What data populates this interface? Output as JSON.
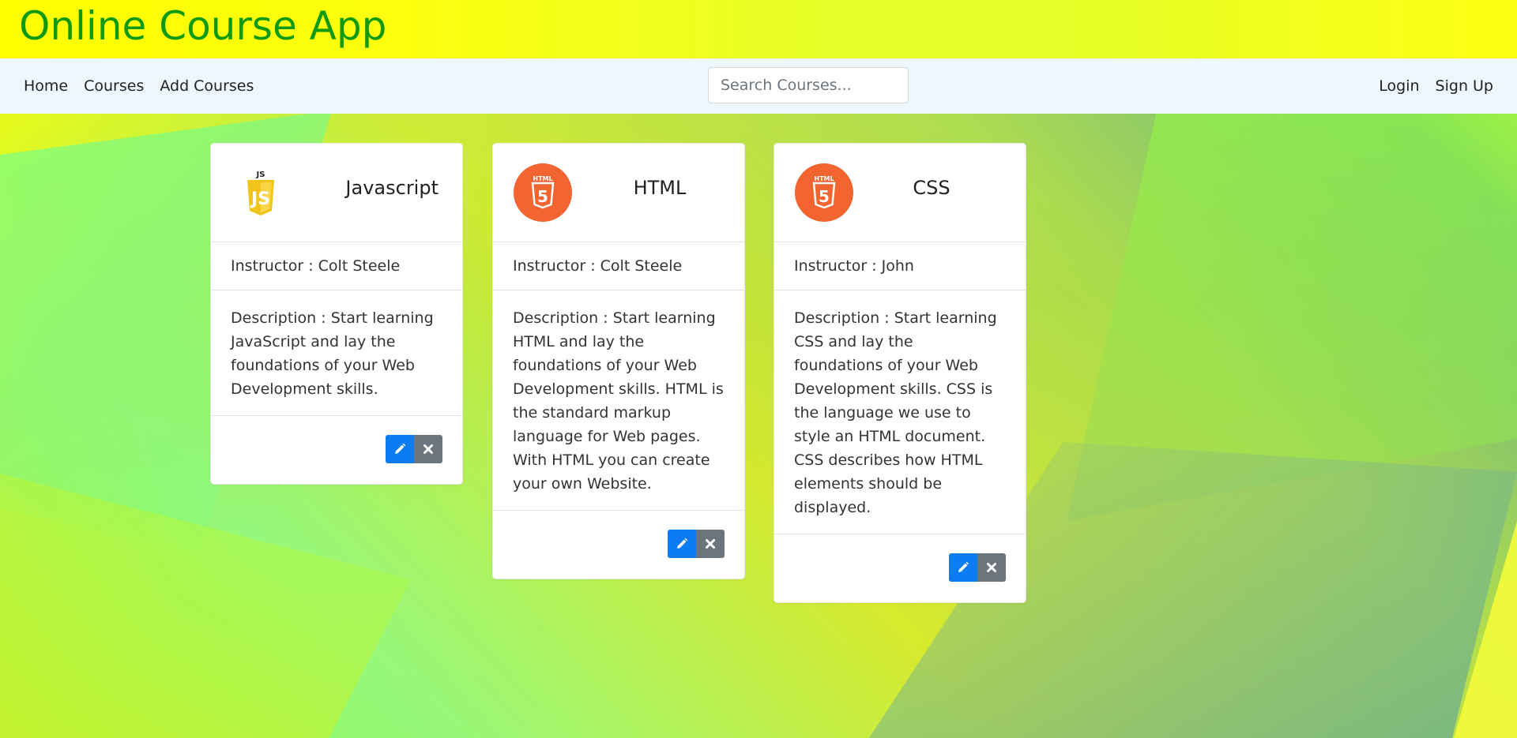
{
  "app": {
    "title": "Online Course App"
  },
  "nav": {
    "left": [
      "Home",
      "Courses",
      "Add Courses"
    ],
    "right": [
      "Login",
      "Sign Up"
    ],
    "search_placeholder": "Search Courses..."
  },
  "courses": [
    {
      "title": "Javascript",
      "logo": "javascript-logo-icon",
      "instructor": "Instructor : Colt Steele",
      "description": "Description : Start learning JavaScript and lay the foundations of your Web Development skills."
    },
    {
      "title": "HTML",
      "logo": "html5-logo-icon",
      "instructor": "Instructor : Colt Steele",
      "description": "Description : Start learning HTML and lay the foundations of your Web Development skills. HTML is the standard markup language for Web pages. With HTML you can create your own Website."
    },
    {
      "title": "CSS",
      "logo": "html5-logo-icon",
      "instructor": "Instructor : John",
      "description": "Description : Start learning CSS and lay the foundations of your Web Development skills. CSS is the language we use to style an HTML document. CSS describes how HTML elements should be displayed."
    }
  ],
  "icons": {
    "edit": "pencil-icon",
    "delete": "close-icon"
  },
  "colors": {
    "title_green": "#109a10",
    "edit_blue": "#0d7cf2",
    "delete_gray": "#6c757d",
    "html_orange": "#f26430",
    "js_yellow": "#f0c419"
  }
}
